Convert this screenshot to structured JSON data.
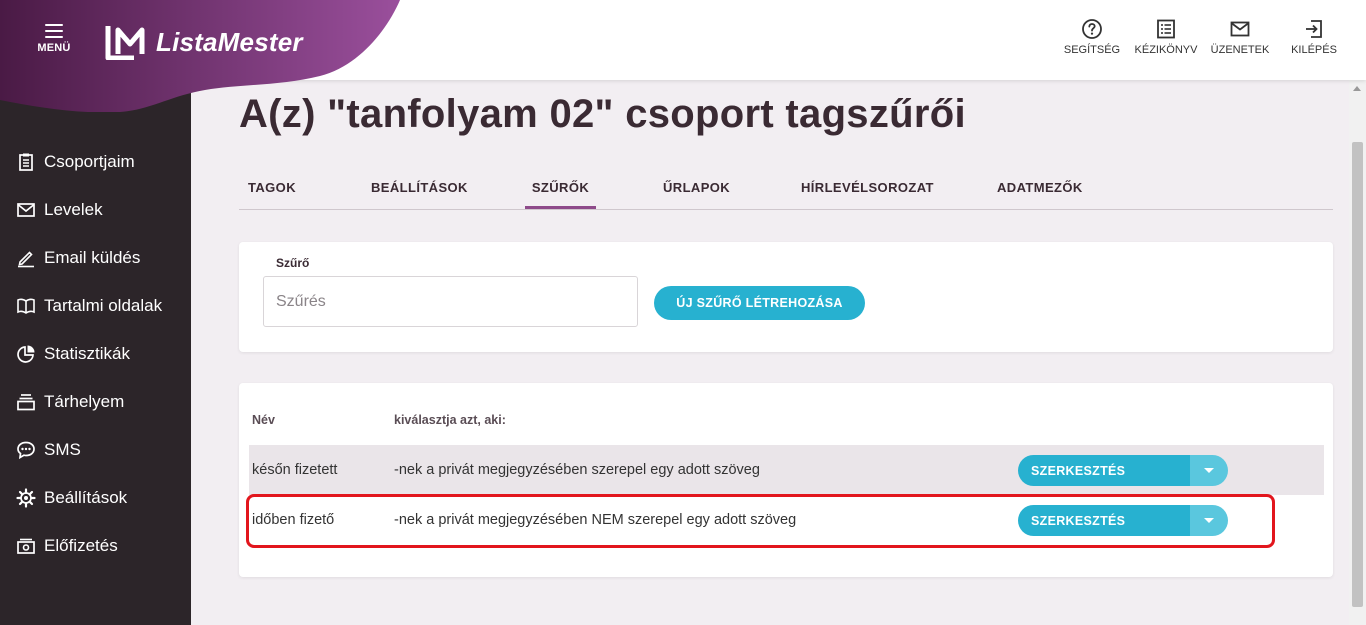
{
  "brand": {
    "menu_label": "MENÜ",
    "logo_text": "ListaMester",
    "gradient_start": "#4a1a45",
    "gradient_end": "#9a4f9c"
  },
  "top_actions": [
    {
      "label": "SEGÍTSÉG",
      "icon": "help-circle-icon"
    },
    {
      "label": "KÉZIKÖNYV",
      "icon": "manual-list-icon"
    },
    {
      "label": "ÜZENETEK",
      "icon": "mail-icon"
    },
    {
      "label": "KILÉPÉS",
      "icon": "logout-icon"
    }
  ],
  "sidebar": {
    "items": [
      {
        "label": "Csoportjaim",
        "icon": "clipboard-icon"
      },
      {
        "label": "Levelek",
        "icon": "envelope-icon"
      },
      {
        "label": "Email küldés",
        "icon": "pencil-icon"
      },
      {
        "label": "Tartalmi oldalak",
        "icon": "book-icon"
      },
      {
        "label": "Statisztikák",
        "icon": "pie-chart-icon"
      },
      {
        "label": "Tárhelyem",
        "icon": "storage-icon"
      },
      {
        "label": "SMS",
        "icon": "chat-bubble-icon"
      },
      {
        "label": "Beállítások",
        "icon": "gear-icon"
      },
      {
        "label": "Előfizetés",
        "icon": "money-icon"
      }
    ]
  },
  "page": {
    "title": "A(z) \"tanfolyam 02\" csoport tagszűrői"
  },
  "tabs": [
    {
      "label": "TAGOK"
    },
    {
      "label": "BEÁLLÍTÁSOK"
    },
    {
      "label": "SZŰRŐK",
      "active": true
    },
    {
      "label": "ŰRLAPOK"
    },
    {
      "label": "HÍRLEVÉLSOROZAT"
    },
    {
      "label": "ADATMEZŐK"
    }
  ],
  "filter_card": {
    "field_label": "Szűrő",
    "input_placeholder": "Szűrés",
    "input_value": "",
    "new_button_label": "ÚJ SZŰRŐ LÉTREHOZÁSA"
  },
  "table": {
    "headers": {
      "name": "Név",
      "criteria": "kiválasztja azt, aki:"
    },
    "rows": [
      {
        "name": "későn fizetett",
        "criteria": "-nek a privát megjegyzésében szerepel egy adott szöveg",
        "action": "SZERKESZTÉS"
      },
      {
        "name": "időben fizető",
        "criteria": "-nek a privát megjegyzésében NEM szerepel egy adott szöveg",
        "action": "SZERKESZTÉS"
      }
    ]
  },
  "colors": {
    "accent": "#27b1d0",
    "accent_light": "#5ac7de",
    "tab_active": "#8e4a8a",
    "sidebar_bg": "#2c2529",
    "highlight": "#e2161d"
  }
}
